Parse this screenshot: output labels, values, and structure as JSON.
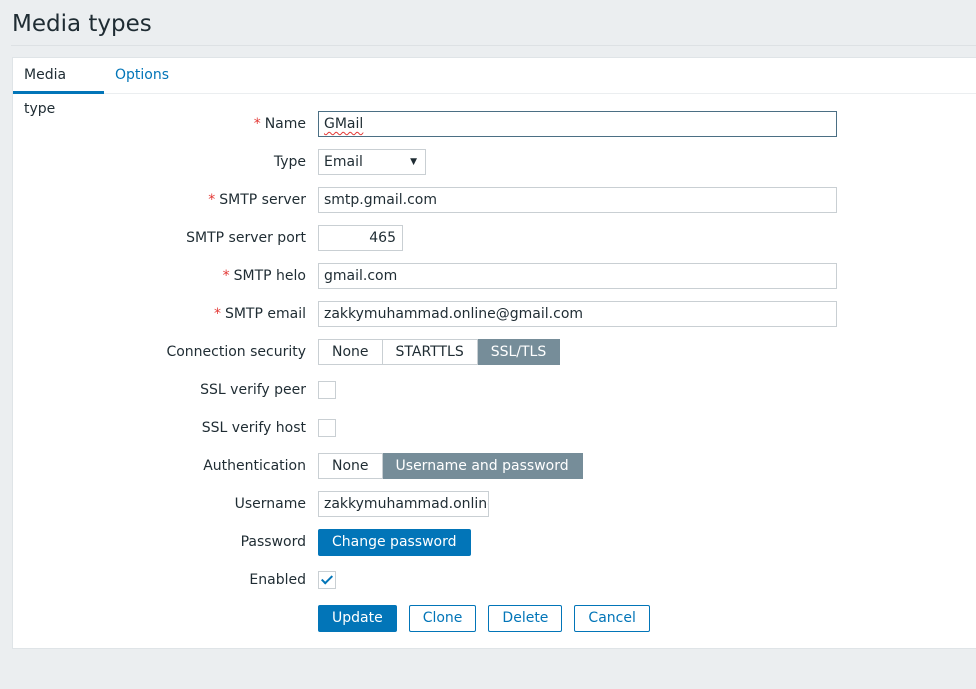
{
  "page": {
    "title": "Media types"
  },
  "tabs": [
    {
      "label": "Media type",
      "active": true
    },
    {
      "label": "Options",
      "active": false
    }
  ],
  "form": {
    "name": {
      "label": "Name",
      "required": "*",
      "value": "GMail"
    },
    "type": {
      "label": "Type",
      "value": "Email"
    },
    "smtp_server": {
      "label": "SMTP server",
      "required": "*",
      "value": "smtp.gmail.com"
    },
    "smtp_port": {
      "label": "SMTP server port",
      "value": "465"
    },
    "smtp_helo": {
      "label": "SMTP helo",
      "required": "*",
      "value": "gmail.com"
    },
    "smtp_email": {
      "label": "SMTP email",
      "required": "*",
      "value": "zakkymuhammad.online@gmail.com"
    },
    "connection_security": {
      "label": "Connection security",
      "options": [
        "None",
        "STARTTLS",
        "SSL/TLS"
      ],
      "selected": "SSL/TLS"
    },
    "ssl_verify_peer": {
      "label": "SSL verify peer",
      "checked": false
    },
    "ssl_verify_host": {
      "label": "SSL verify host",
      "checked": false
    },
    "authentication": {
      "label": "Authentication",
      "options": [
        "None",
        "Username and password"
      ],
      "selected": "Username and password"
    },
    "username": {
      "label": "Username",
      "value": "zakkymuhammad.online@"
    },
    "password": {
      "label": "Password",
      "button": "Change password"
    },
    "enabled": {
      "label": "Enabled",
      "checked": true
    }
  },
  "actions": {
    "update": "Update",
    "clone": "Clone",
    "delete": "Delete",
    "cancel": "Cancel"
  },
  "colors": {
    "accent": "#0275b8",
    "segment_selected": "#768d99",
    "required": "#e33734",
    "background": "#ebeef0"
  }
}
